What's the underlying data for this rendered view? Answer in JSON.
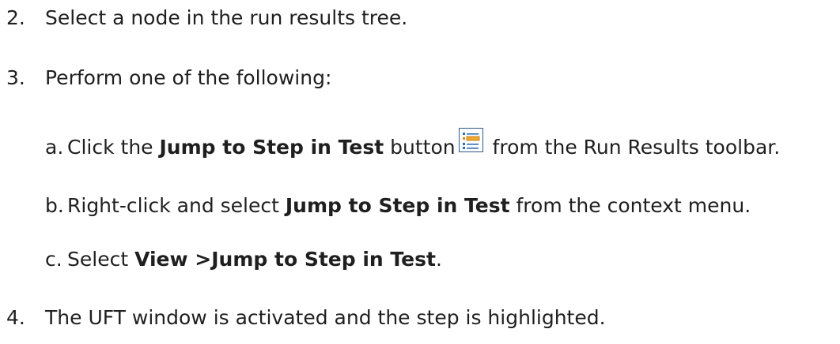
{
  "steps": [
    {
      "marker": "2.",
      "text": "Select a node in the run results tree."
    },
    {
      "marker": "3.",
      "text": "Perform one of the following:"
    }
  ],
  "substeps": {
    "a": {
      "marker": "a.",
      "pre": "Click the ",
      "bold": "Jump to Step in Test",
      "mid": " button",
      "icon": "jump-to-step-icon",
      "post": " from the Run Results toolbar."
    },
    "b": {
      "marker": "b.",
      "pre": "Right-click and select ",
      "bold": "Jump to Step in Test",
      "post": " from the context menu."
    },
    "c": {
      "marker": "c.",
      "pre": "Select ",
      "bold": "View >Jump to Step in Test",
      "post": "."
    }
  },
  "final_step": {
    "marker": "4.",
    "text": "The UFT window is activated and the step is highlighted."
  }
}
